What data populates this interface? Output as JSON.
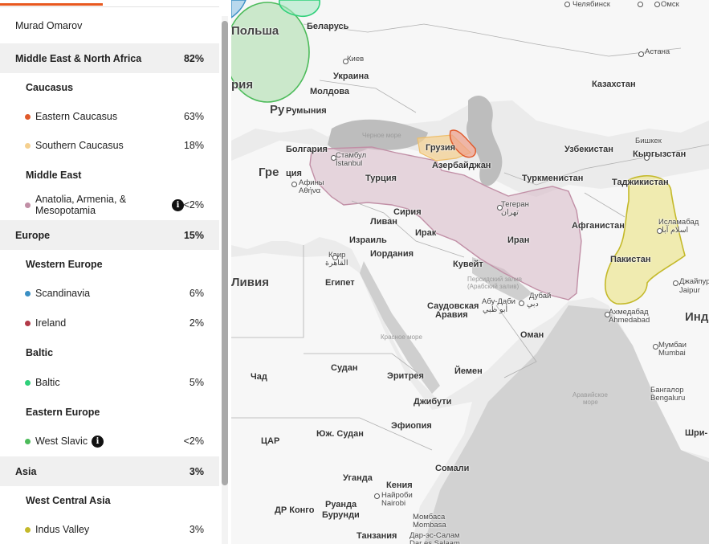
{
  "panel": {
    "user_name": "Murad Omarov",
    "rows": [
      {
        "kind": "region",
        "label": "Middle East & North Africa",
        "pct": "82%"
      },
      {
        "kind": "sub",
        "label": "Caucasus"
      },
      {
        "kind": "item",
        "label": "Eastern Caucasus",
        "pct": "63%",
        "color": "#e05a2b"
      },
      {
        "kind": "item",
        "label": "Southern Caucasus",
        "pct": "18%",
        "color": "#f5d08f"
      },
      {
        "kind": "sub",
        "label": "Middle East"
      },
      {
        "kind": "item",
        "label": "Anatolia, Armenia, &",
        "label2": "Mesopotamia",
        "pct": "<2%",
        "color": "#c18fa6",
        "info": true
      },
      {
        "kind": "region",
        "label": "Europe",
        "pct": "15%"
      },
      {
        "kind": "sub",
        "label": "Western Europe"
      },
      {
        "kind": "item",
        "label": "Scandinavia",
        "pct": "6%",
        "color": "#3a8fc4"
      },
      {
        "kind": "item",
        "label": "Ireland",
        "pct": "2%",
        "color": "#b23a48"
      },
      {
        "kind": "sub",
        "label": "Baltic"
      },
      {
        "kind": "item",
        "label": "Baltic",
        "pct": "5%",
        "color": "#2fd07a"
      },
      {
        "kind": "sub",
        "label": "Eastern Europe"
      },
      {
        "kind": "item",
        "label": "West Slavic",
        "pct": "<2%",
        "color": "#4cbb5a",
        "info": true
      },
      {
        "kind": "region",
        "label": "Asia",
        "pct": "3%"
      },
      {
        "kind": "sub",
        "label": "West Central Asia"
      },
      {
        "kind": "item",
        "label": "Indus Valley",
        "pct": "3%",
        "color": "#c4b92a"
      }
    ]
  },
  "map": {
    "labels": [
      {
        "t": "Польша",
        "c": "xl"
      },
      {
        "t": "рия",
        "c": "xl"
      },
      {
        "t": "Ру",
        "c": "xl"
      },
      {
        "t": "Гре",
        "c": "xl"
      },
      {
        "t": "Ливия",
        "c": "xl"
      },
      {
        "t": "Беларусь",
        "c": "b"
      },
      {
        "t": "Киев",
        "c": "city"
      },
      {
        "t": "Украина",
        "c": "b"
      },
      {
        "t": "Молдова",
        "c": "b"
      },
      {
        "t": "Румыния",
        "c": "b"
      },
      {
        "t": "Болгария",
        "c": "b"
      },
      {
        "t": "Стамбул",
        "c": "city"
      },
      {
        "t": "İstanbul",
        "c": "city"
      },
      {
        "t": "ция",
        "c": "b"
      },
      {
        "t": "Афины",
        "c": "city"
      },
      {
        "t": "Αθήνα",
        "c": "city"
      },
      {
        "t": "Турция",
        "c": "b"
      },
      {
        "t": "Грузия",
        "c": "b"
      },
      {
        "t": "Азербайджан",
        "c": "b"
      },
      {
        "t": "Черное море",
        "c": "sea"
      },
      {
        "t": "Ливан",
        "c": "b"
      },
      {
        "t": "Сирия",
        "c": "b"
      },
      {
        "t": "Израиль",
        "c": "b"
      },
      {
        "t": "Иордания",
        "c": "b"
      },
      {
        "t": "Ирак",
        "c": "b"
      },
      {
        "t": "Иран",
        "c": "b"
      },
      {
        "t": "Тегеран",
        "c": "city"
      },
      {
        "t": "تهران",
        "c": "city"
      },
      {
        "t": "Кувейт",
        "c": "b"
      },
      {
        "t": "Каир",
        "c": "city"
      },
      {
        "t": "القاهرة",
        "c": "city"
      },
      {
        "t": "Египет",
        "c": "b"
      },
      {
        "t": "Саудовская",
        "c": "b"
      },
      {
        "t": "Аравия",
        "c": "b"
      },
      {
        "t": "Персидский залив",
        "c": "sea"
      },
      {
        "t": "(Арабский залив)",
        "c": "sea"
      },
      {
        "t": "Абу-Даби",
        "c": "city"
      },
      {
        "t": "أبو ظبي",
        "c": "city"
      },
      {
        "t": "Дубай",
        "c": "city"
      },
      {
        "t": "دبي",
        "c": "city"
      },
      {
        "t": "Оман",
        "c": "b"
      },
      {
        "t": "Красное море",
        "c": "sea"
      },
      {
        "t": "Казахстан",
        "c": "b"
      },
      {
        "t": "Астана",
        "c": "city"
      },
      {
        "t": "Челябинск",
        "c": "city"
      },
      {
        "t": "Омск",
        "c": "city"
      },
      {
        "t": "Узбекистан",
        "c": "b"
      },
      {
        "t": "Туркменистан",
        "c": "b"
      },
      {
        "t": "Бишкек",
        "c": "city"
      },
      {
        "t": "Кыргызстан",
        "c": "b"
      },
      {
        "t": "Таджикистан",
        "c": "b"
      },
      {
        "t": "Афганистан",
        "c": "b"
      },
      {
        "t": "Исламабад",
        "c": "city"
      },
      {
        "t": "اسلام آباد",
        "c": "city"
      },
      {
        "t": "Пакистан",
        "c": "b"
      },
      {
        "t": "Джайпур",
        "c": "city"
      },
      {
        "t": "Jaipur",
        "c": "city"
      },
      {
        "t": "Ахмедабад",
        "c": "city"
      },
      {
        "t": "Ahmedabad",
        "c": "city"
      },
      {
        "t": "Инд",
        "c": "xl"
      },
      {
        "t": "Мумбаи",
        "c": "city"
      },
      {
        "t": "Mumbai",
        "c": "city"
      },
      {
        "t": "Бангалор",
        "c": "city"
      },
      {
        "t": "Bengaluru",
        "c": "city"
      },
      {
        "t": "Шри-",
        "c": "b"
      },
      {
        "t": "Аравийское",
        "c": "sea"
      },
      {
        "t": "море",
        "c": "sea"
      },
      {
        "t": "Йемен",
        "c": "b"
      },
      {
        "t": "Судан",
        "c": "b"
      },
      {
        "t": "Чад",
        "c": "b"
      },
      {
        "t": "Эритрея",
        "c": "b"
      },
      {
        "t": "Джибути",
        "c": "b"
      },
      {
        "t": "Эфиопия",
        "c": "b"
      },
      {
        "t": "Юж. Судан",
        "c": "b"
      },
      {
        "t": "ЦАР",
        "c": "b"
      },
      {
        "t": "Сомали",
        "c": "b"
      },
      {
        "t": "Уганда",
        "c": "b"
      },
      {
        "t": "Кения",
        "c": "b"
      },
      {
        "t": "Найроби",
        "c": "city"
      },
      {
        "t": "Nairobi",
        "c": "city"
      },
      {
        "t": "ДР Конго",
        "c": "b"
      },
      {
        "t": "Руанда",
        "c": "b"
      },
      {
        "t": "Бурунди",
        "c": "b"
      },
      {
        "t": "Момбаса",
        "c": "city"
      },
      {
        "t": "Mombasa",
        "c": "city"
      },
      {
        "t": "Танзания",
        "c": "b"
      },
      {
        "t": "Дар-эс-Салам",
        "c": "city"
      },
      {
        "t": "Dar es Salaam",
        "c": "city"
      }
    ]
  }
}
